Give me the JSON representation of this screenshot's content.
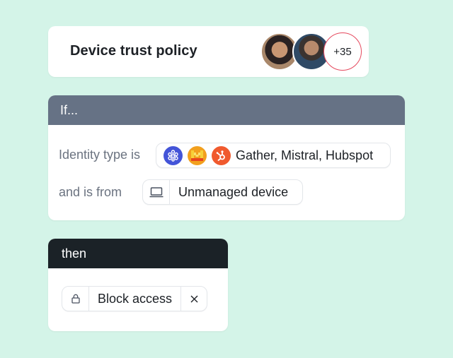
{
  "policy": {
    "title": "Device trust policy",
    "more_count": "+35"
  },
  "if_block": {
    "header": "If...",
    "identity_label": "Identity type is",
    "identity_apps": [
      {
        "name": "Gather",
        "icon": "gather-icon",
        "color": "#4354d8"
      },
      {
        "name": "Mistral",
        "icon": "mistral-icon",
        "color": "#f2a01e"
      },
      {
        "name": "Hubspot",
        "icon": "hubspot-icon",
        "color": "#f05a2e"
      }
    ],
    "identity_value": "Gather, Mistral, Hubspot",
    "from_label": "and is from",
    "device_value": "Unmanaged device",
    "device_icon": "laptop-icon"
  },
  "then_block": {
    "header": "then",
    "action_value": "Block access",
    "action_icon": "lock-icon",
    "remove_icon": "close-icon"
  },
  "colors": {
    "background": "#d4f4e8",
    "if_header": "#667285",
    "then_header": "#1b2227",
    "count_ring": "#e5485d"
  }
}
